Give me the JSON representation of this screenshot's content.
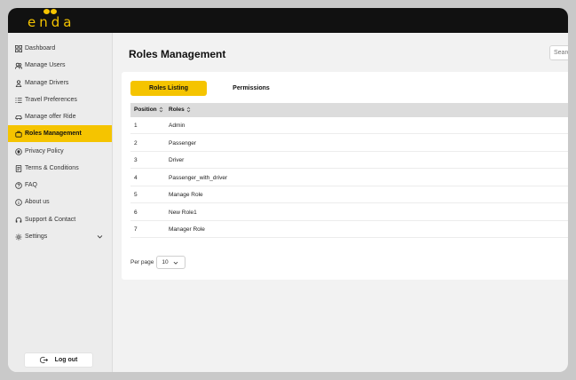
{
  "brand": {
    "name": "enda",
    "accent": "#f5c400"
  },
  "sidebar": {
    "items": [
      {
        "label": "Dashboard",
        "icon": "dashboard-grid-icon"
      },
      {
        "label": "Manage Users",
        "icon": "users-icon"
      },
      {
        "label": "Manage Drivers",
        "icon": "driver-icon"
      },
      {
        "label": "Travel Preferences",
        "icon": "list-icon"
      },
      {
        "label": "Manage offer Ride",
        "icon": "car-icon"
      },
      {
        "label": "Roles Management",
        "icon": "roles-icon",
        "active": true
      },
      {
        "label": "Privacy Policy",
        "icon": "shield-icon"
      },
      {
        "label": "Terms & Conditions",
        "icon": "document-icon"
      },
      {
        "label": "FAQ",
        "icon": "question-icon"
      },
      {
        "label": "About us",
        "icon": "info-icon"
      },
      {
        "label": "Support & Contact",
        "icon": "headset-icon"
      },
      {
        "label": "Settings",
        "icon": "gear-icon",
        "has_submenu": true
      }
    ],
    "logout_label": "Log out"
  },
  "header": {
    "title": "Roles Management",
    "search_placeholder": "Search"
  },
  "tabs": [
    {
      "label": "Roles Listing",
      "active": true
    },
    {
      "label": "Permissions",
      "active": false
    }
  ],
  "table": {
    "columns": [
      "Position",
      "Roles"
    ],
    "rows": [
      {
        "position": "1",
        "role": "Admin"
      },
      {
        "position": "2",
        "role": "Passenger"
      },
      {
        "position": "3",
        "role": "Driver"
      },
      {
        "position": "4",
        "role": "Passenger_with_driver"
      },
      {
        "position": "5",
        "role": "Manage Role"
      },
      {
        "position": "6",
        "role": "New Role1"
      },
      {
        "position": "7",
        "role": "Manager Role"
      }
    ]
  },
  "pagination": {
    "per_page_label": "Per page",
    "per_page_value": "10"
  }
}
